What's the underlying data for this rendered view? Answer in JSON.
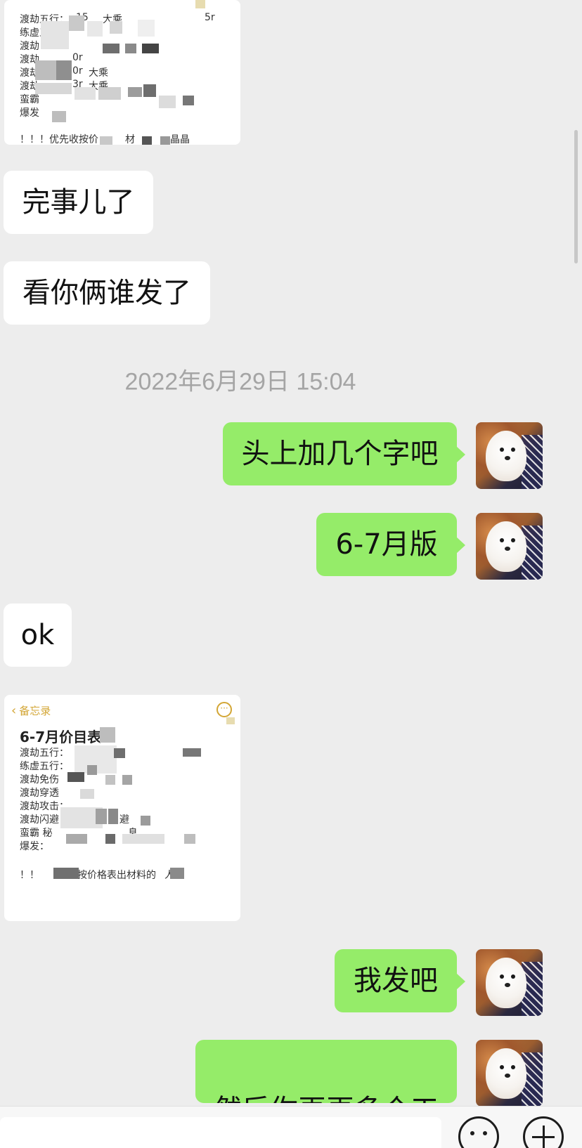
{
  "chat": {
    "memo_top": {
      "lines": [
        "渡劫五行：",
        "练虚五",
        "渡劫",
        "渡劫",
        "渡劫",
        "渡劫",
        "蛮霸",
        "爆发"
      ],
      "inline_bits": [
        "15",
        "大乘",
        "5r",
        "0r",
        "0r",
        "大乘",
        "3r",
        "大乘"
      ],
      "footer": "！！！优先收按价",
      "footer_tail": "材",
      "footer_end": "晶晶"
    },
    "messages": [
      {
        "side": "in",
        "text": "完事儿了"
      },
      {
        "side": "in",
        "text": "看你俩谁发了"
      },
      {
        "side": "out",
        "text": "头上加几个字吧"
      },
      {
        "side": "out",
        "text": "6-7月版"
      },
      {
        "side": "in",
        "text": "ok"
      },
      {
        "side": "out",
        "text": "我发吧"
      },
      {
        "side": "out",
        "text": "然后你再再多个工"
      }
    ],
    "timestamp": "2022年6月29日 15:04",
    "memo_bottom": {
      "back_label": "备忘录",
      "more_label": "···",
      "title": "6-7月价目表",
      "lines": [
        "渡劫五行：",
        "练虚五行：",
        "渡劫免伤",
        "渡劫穿透",
        "渡劫攻击：",
        "渡劫闪避",
        "蛮霸 秘",
        "爆发："
      ],
      "line_tails": [
        "",
        "",
        "",
        "",
        "",
        "避",
        "息",
        ""
      ],
      "footer_start": "！！",
      "footer_mid": "按价格表出材料的",
      "footer_end": "人"
    }
  },
  "colors": {
    "background": "#ededed",
    "incoming_bubble": "#ffffff",
    "outgoing_bubble": "#95ec69",
    "timestamp": "#a5a5a5",
    "memo_accent": "#d3a635"
  },
  "icons": {
    "back": "chevron-left-icon",
    "more": "ellipsis-icon",
    "emoji": "emoji-icon",
    "plus": "plus-icon"
  }
}
